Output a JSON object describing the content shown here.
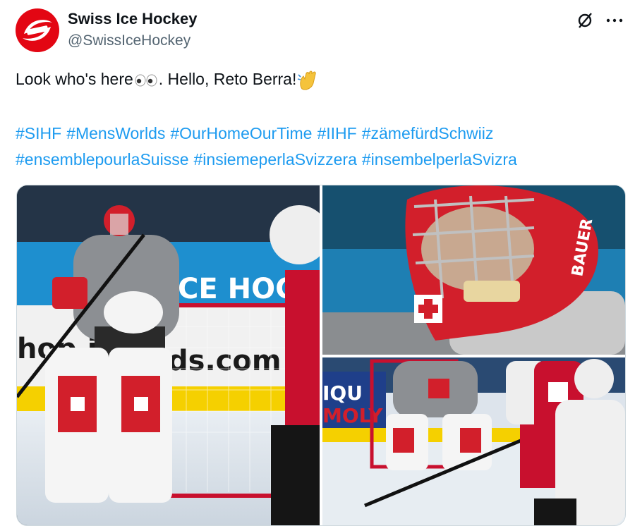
{
  "account": {
    "name": "Swiss Ice Hockey",
    "handle": "@SwissIceHockey"
  },
  "tweet": {
    "text_part1": "Look who's here",
    "text_part2": ". Hello, Reto Berra!",
    "hashtags": [
      "#SIHF",
      "#MensWorlds",
      "#OurHomeOurTime",
      "#IIHF",
      "#zämefürdSchwiiz",
      "#ensemblepourlaSuisse",
      "#insiemeperlaSvizzera",
      "#insembelperlaSvizra"
    ]
  },
  "media": {
    "photo1_signs": {
      "ice_hockey": "CE HOCKE",
      "website": "ds.com",
      "shop": "hop.i"
    },
    "photo3_sign": {
      "line1": "IQU",
      "line2": "MOLY"
    },
    "helmet_brand": "BAUER"
  },
  "icons": [
    "avatar-logo",
    "grok-icon",
    "more-icon",
    "eyes-emoji",
    "wave-emoji"
  ],
  "colors": {
    "brand": "#e30613",
    "link": "#1d9bf0",
    "handle": "#536471"
  }
}
